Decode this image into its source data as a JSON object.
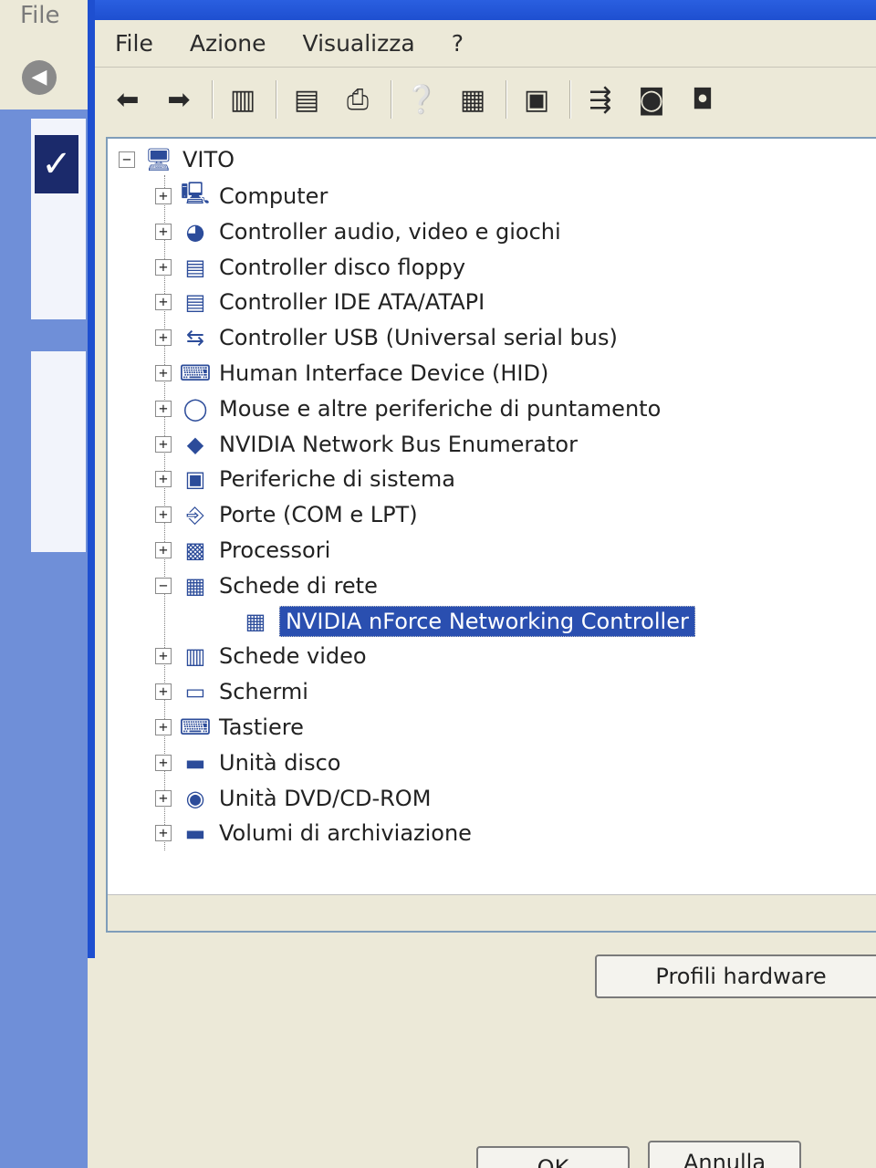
{
  "background_window": {
    "menu_file": "File"
  },
  "menu": {
    "file": "File",
    "action": "Azione",
    "view": "Visualizza",
    "help": "?"
  },
  "toolbar": {
    "icons": [
      "back-arrow-icon",
      "forward-arrow-icon",
      "show-hide-tree-icon",
      "properties-icon",
      "print-icon",
      "help-icon",
      "console-icon",
      "update-driver-icon",
      "scan-hardware-icon",
      "disable-device-icon",
      "uninstall-device-icon"
    ]
  },
  "tree": {
    "root": "VITO",
    "categories": [
      {
        "label": "Computer",
        "icon": "computer-icon",
        "expanded": false
      },
      {
        "label": "Controller audio, video e giochi",
        "icon": "audio-icon",
        "expanded": false
      },
      {
        "label": "Controller disco floppy",
        "icon": "floppy-controller-icon",
        "expanded": false
      },
      {
        "label": "Controller IDE ATA/ATAPI",
        "icon": "ide-controller-icon",
        "expanded": false
      },
      {
        "label": "Controller USB (Universal serial bus)",
        "icon": "usb-icon",
        "expanded": false
      },
      {
        "label": "Human Interface Device (HID)",
        "icon": "hid-icon",
        "expanded": false
      },
      {
        "label": "Mouse e altre periferiche di puntamento",
        "icon": "mouse-icon",
        "expanded": false
      },
      {
        "label": "NVIDIA Network Bus Enumerator",
        "icon": "network-bus-icon",
        "expanded": false
      },
      {
        "label": "Periferiche di sistema",
        "icon": "system-device-icon",
        "expanded": false
      },
      {
        "label": "Porte (COM e LPT)",
        "icon": "port-icon",
        "expanded": false
      },
      {
        "label": "Processori",
        "icon": "processor-icon",
        "expanded": false
      },
      {
        "label": "Schede di rete",
        "icon": "network-adapter-icon",
        "expanded": true
      },
      {
        "label": "NVIDIA nForce Networking Controller",
        "icon": "network-card-icon",
        "child": true,
        "selected": true
      },
      {
        "label": "Schede video",
        "icon": "display-adapter-icon",
        "expanded": false
      },
      {
        "label": "Schermi",
        "icon": "monitor-icon",
        "expanded": false
      },
      {
        "label": "Tastiere",
        "icon": "keyboard-icon",
        "expanded": false
      },
      {
        "label": "Unità disco",
        "icon": "disk-drive-icon",
        "expanded": false
      },
      {
        "label": "Unità DVD/CD-ROM",
        "icon": "dvd-drive-icon",
        "expanded": false
      },
      {
        "label": "Volumi di archiviazione",
        "icon": "storage-volume-icon",
        "expanded": false
      }
    ]
  },
  "buttons": {
    "hardware_profiles": "Profili hardware",
    "ok": "OK",
    "cancel": "Annulla"
  },
  "colors": {
    "selection": "#2a4fb0",
    "window_border": "#1e4fd0"
  }
}
